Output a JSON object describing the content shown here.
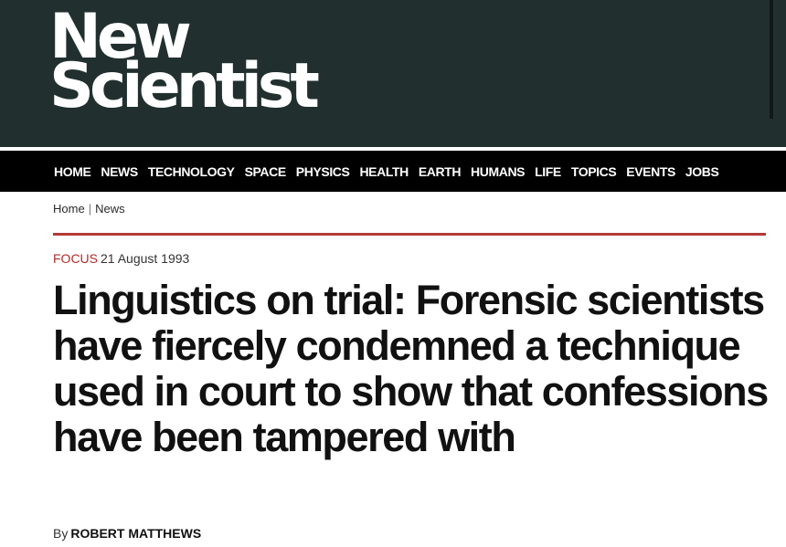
{
  "logo": {
    "line1": "New",
    "line2": "Scientist"
  },
  "nav": {
    "items": [
      "HOME",
      "NEWS",
      "TECHNOLOGY",
      "SPACE",
      "PHYSICS",
      "HEALTH",
      "EARTH",
      "HUMANS",
      "LIFE",
      "TOPICS",
      "EVENTS",
      "JOBS"
    ]
  },
  "breadcrumb": {
    "home": "Home",
    "separator": "|",
    "section": "News"
  },
  "article": {
    "category": "FOCUS",
    "date": "21 August 1993",
    "headline": "Linguistics on trial: Forensic scientists have fiercely condemned a technique used in court to show that confessions have been tampered with",
    "byline_prefix": "By",
    "author": "ROBERT MATTHEWS"
  },
  "colors": {
    "masthead_bg": "#21302f",
    "nav_bg": "#000000",
    "accent": "#b43a36",
    "category": "#b32c28"
  }
}
